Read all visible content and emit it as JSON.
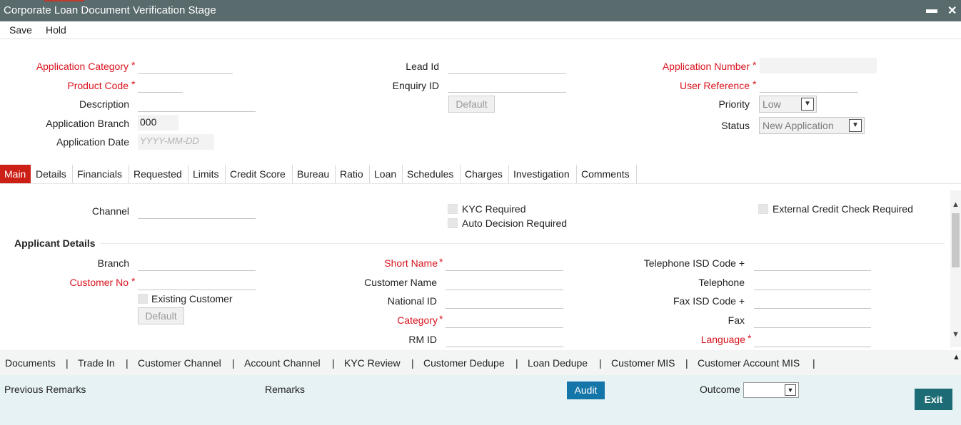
{
  "window": {
    "title": "Corporate Loan Document Verification Stage",
    "minimize": "▬",
    "close": "✕"
  },
  "menu": {
    "save": "Save",
    "hold": "Hold"
  },
  "header": {
    "application_category_label": "Application Category",
    "product_code_label": "Product Code",
    "description_label": "Description",
    "application_branch_label": "Application Branch",
    "application_branch_value": "000",
    "application_date_label": "Application Date",
    "application_date_placeholder": "YYYY-MM-DD",
    "lead_id_label": "Lead Id",
    "enquiry_id_label": "Enquiry ID",
    "default_button": "Default",
    "application_number_label": "Application Number",
    "user_reference_label": "User Reference",
    "priority_label": "Priority",
    "priority_value": "Low",
    "status_label": "Status",
    "status_value": "New Application",
    "required_mark": "*"
  },
  "tabs": [
    "Main",
    "Details",
    "Financials",
    "Requested",
    "Limits",
    "Credit Score",
    "Bureau",
    "Ratio",
    "Loan",
    "Schedules",
    "Charges",
    "Investigation",
    "Comments"
  ],
  "main": {
    "channel_label": "Channel",
    "kyc_required": "KYC Required",
    "auto_decision_required": "Auto Decision Required",
    "external_credit_check_required": "External Credit Check Required",
    "applicant_details_title": "Applicant Details",
    "branch_label": "Branch",
    "customer_no_label": "Customer No",
    "existing_customer": "Existing Customer",
    "default_button": "Default",
    "short_name_label": "Short Name",
    "customer_name_label": "Customer Name",
    "national_id_label": "National ID",
    "category_label": "Category",
    "rm_id_label": "RM ID",
    "telephone_isd_label": "Telephone ISD Code +",
    "telephone_label": "Telephone",
    "fax_isd_label": "Fax ISD Code +",
    "fax_label": "Fax",
    "language_label": "Language"
  },
  "links": [
    "Documents",
    "Trade In",
    "Customer Channel",
    "Account Channel",
    "KYC Review",
    "Customer Dedupe",
    "Loan Dedupe",
    "Customer MIS",
    "Customer Account MIS"
  ],
  "link_separator": "|",
  "footer": {
    "previous_remarks": "Previous Remarks",
    "remarks": "Remarks",
    "audit": "Audit",
    "outcome": "Outcome",
    "exit": "Exit"
  },
  "icons": {
    "caret": "▼",
    "scroll_up": "▲",
    "scroll_down": "▼",
    "collapse": "▲"
  },
  "colors": {
    "title_bar": "#5a6b6d",
    "mandatory": "#d9131d",
    "active_tab": "#cc1f16",
    "audit": "#1475a9",
    "exit": "#1c6b75"
  }
}
